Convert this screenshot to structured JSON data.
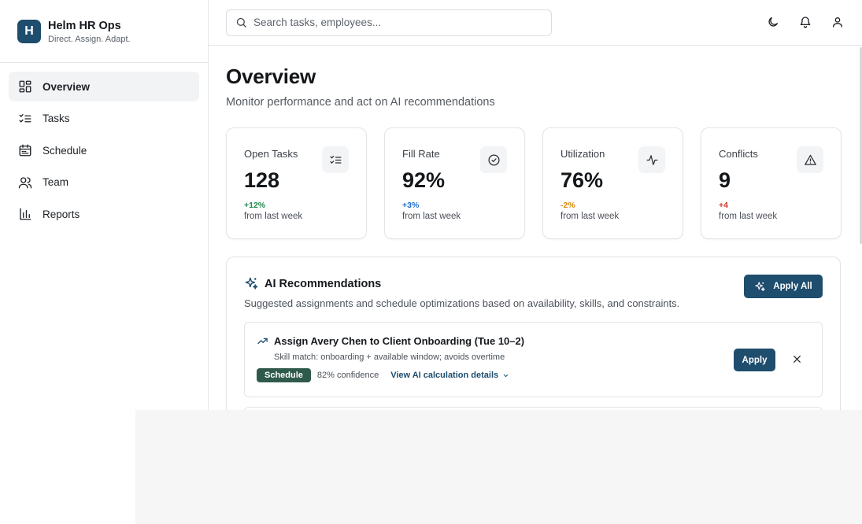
{
  "brand": {
    "logo_letter": "H",
    "name": "Helm HR Ops",
    "tagline": "Direct. Assign. Adapt."
  },
  "nav": {
    "items": [
      {
        "label": "Overview",
        "icon": "layout-grid-icon",
        "active": true
      },
      {
        "label": "Tasks",
        "icon": "list-checks-icon",
        "active": false
      },
      {
        "label": "Schedule",
        "icon": "calendar-icon",
        "active": false
      },
      {
        "label": "Team",
        "icon": "users-icon",
        "active": false
      },
      {
        "label": "Reports",
        "icon": "bar-chart-icon",
        "active": false
      }
    ]
  },
  "search": {
    "placeholder": "Search tasks, employees..."
  },
  "topbar": {
    "icons": [
      "moon-icon",
      "bell-icon",
      "user-icon"
    ]
  },
  "page": {
    "title": "Overview",
    "subtitle": "Monitor performance and act on AI recommendations"
  },
  "stats": [
    {
      "label": "Open Tasks",
      "value": "128",
      "delta": "+12%",
      "delta_color": "#1f8a4c",
      "note": "from last week",
      "icon": "list-checks-icon"
    },
    {
      "label": "Fill Rate",
      "value": "92%",
      "delta": "+3%",
      "delta_color": "#1e6ec8",
      "note": "from last week",
      "icon": "check-circle-icon"
    },
    {
      "label": "Utilization",
      "value": "76%",
      "delta": "-2%",
      "delta_color": "#d98a0b",
      "note": "from last week",
      "icon": "activity-icon"
    },
    {
      "label": "Conflicts",
      "value": "9",
      "delta": "+4",
      "delta_color": "#d6372c",
      "note": "from last week",
      "icon": "alert-triangle-icon"
    }
  ],
  "ai": {
    "title": "AI Recommendations",
    "subtitle": "Suggested assignments and schedule optimizations based on availability, skills, and constraints.",
    "apply_all_label": "Apply All",
    "recommendations": [
      {
        "title": "Assign Avery Chen to Client Onboarding (Tue 10–2)",
        "description": "Skill match: onboarding + available window; avoids overtime",
        "badge": "Schedule",
        "confidence": "82% confidence",
        "details_link": "View AI calculation details",
        "apply_label": "Apply"
      }
    ]
  },
  "colors": {
    "brand": "#1e4d6e",
    "badge": "#2f5a4b"
  }
}
